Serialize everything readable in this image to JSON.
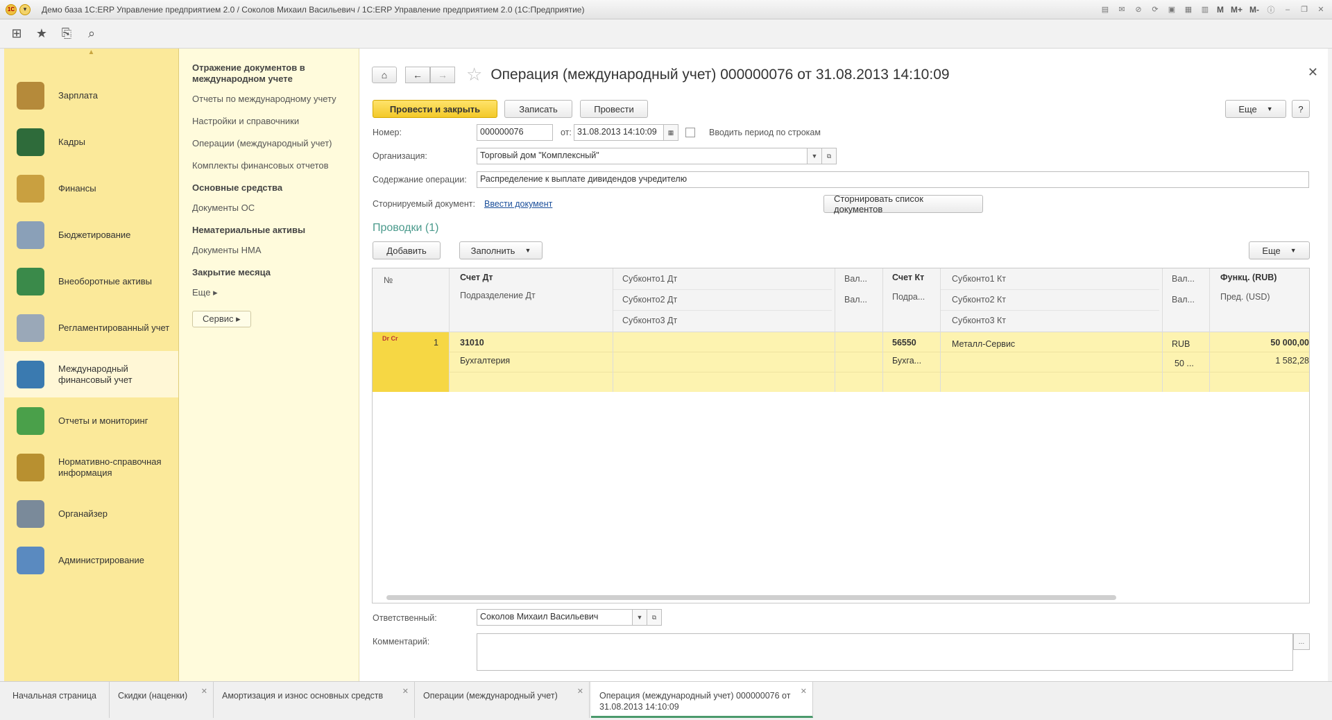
{
  "window": {
    "title": "Демо база 1С:ERP Управление предприятием 2.0 / Соколов Михаил Васильевич / 1С:ERP Управление предприятием 2.0  (1С:Предприятие)",
    "m_labels": [
      "M",
      "M+",
      "M-"
    ]
  },
  "toolbar": {
    "icons": [
      "apps-grid-icon",
      "star-icon",
      "history-icon",
      "search-icon"
    ]
  },
  "sections": [
    {
      "label": "Зарплата",
      "icon": "salary-icon",
      "color": "#b58a3a"
    },
    {
      "label": "Кадры",
      "icon": "hr-icon",
      "color": "#2e6b3a"
    },
    {
      "label": "Финансы",
      "icon": "finance-icon",
      "color": "#c9a040"
    },
    {
      "label": "Бюджетирование",
      "icon": "budget-icon",
      "color": "#8aa0b8"
    },
    {
      "label": "Внеоборотные активы",
      "icon": "assets-icon",
      "color": "#3a8a4a"
    },
    {
      "label": "Регламентированный учет",
      "icon": "regulated-icon",
      "color": "#9aa8b8"
    },
    {
      "label": "Международный финансовый учет",
      "icon": "international-icon",
      "color": "#3a7ab0",
      "active": true
    },
    {
      "label": "Отчеты и мониторинг",
      "icon": "reports-icon",
      "color": "#4aa04a"
    },
    {
      "label": "Нормативно-справочная информация",
      "icon": "reference-icon",
      "color": "#b89030"
    },
    {
      "label": "Органайзер",
      "icon": "organizer-icon",
      "color": "#7a8a9a"
    },
    {
      "label": "Администрирование",
      "icon": "admin-icon",
      "color": "#5a8ac0"
    }
  ],
  "nav": {
    "heading1": "Отражение документов в международном учете",
    "links1": [
      "Отчеты по международному учету",
      "Настройки и справочники",
      "Операции (международный учет)",
      "Комплекты финансовых отчетов"
    ],
    "heading2": "Основные средства",
    "links2": [
      "Документы ОС"
    ],
    "heading3": "Нематериальные активы",
    "links3": [
      "Документы НМА"
    ],
    "heading4": "Закрытие месяца",
    "more": "Еще ▸",
    "service": "Сервис ▸"
  },
  "doc": {
    "title": "Операция (международный учет) 000000076 от 31.08.2013 14:10:09",
    "buttons": {
      "post_close": "Провести и закрыть",
      "save": "Записать",
      "post": "Провести",
      "more": "Еще",
      "help": "?"
    },
    "fields": {
      "number_label": "Номер:",
      "number": "000000076",
      "from_label": "от:",
      "date": "31.08.2013 14:10:09",
      "period_label": "Вводить период по строкам",
      "org_label": "Организация:",
      "org": "Торговый дом \"Комплексный\"",
      "content_label": "Содержание операции:",
      "content": "Распределение к выплате дивидендов учредителю",
      "storno_label": "Сторнируемый документ:",
      "storno_link": "Ввести документ",
      "storno_btn": "Сторнировать список документов"
    },
    "entries": {
      "title": "Проводки (1)",
      "add": "Добавить",
      "fill": "Заполнить",
      "more": "Еще",
      "headers": {
        "no": "№",
        "acc_dt": "Счет Дт",
        "dept_dt": "Подразделение Дт",
        "sub1_dt": "Субконто1 Дт",
        "sub2_dt": "Субконто2 Дт",
        "sub3_dt": "Субконто3 Дт",
        "cur_dt1": "Вал...",
        "cur_dt2": "Вал...",
        "acc_kt": "Счет Кт",
        "dept_kt": "Подра...",
        "sub1_kt": "Субконто1 Кт",
        "sub2_kt": "Субконто2 Кт",
        "sub3_kt": "Субконто3 Кт",
        "cur_kt1": "Вал...",
        "cur_kt2": "Вал...",
        "func": "Функц. (RUB)",
        "pres": "Пред. (USD)"
      },
      "rows": [
        {
          "icon": "Dr Cr",
          "no": "1",
          "acc_dt": "31010",
          "dept_dt": "Бухгалтерия",
          "acc_kt": "56550",
          "dept_kt": "Бухга...",
          "sub1_kt": "Металл-Сервис",
          "cur_kt": "RUB",
          "cur_kt2": "50 ...",
          "func": "50 000,00",
          "pres": "1 582,28"
        }
      ]
    },
    "responsible_label": "Ответственный:",
    "responsible": "Соколов Михаил Васильевич",
    "comment_label": "Комментарий:",
    "comment": ""
  },
  "tabs": [
    {
      "label": "Начальная страница"
    },
    {
      "label": "Скидки (наценки)"
    },
    {
      "label": "Амортизация и износ основных средств"
    },
    {
      "label": "Операции (международный учет)"
    },
    {
      "label": "Операция (международный учет) 000000076 от 31.08.2013 14:10:09",
      "active": true
    }
  ]
}
